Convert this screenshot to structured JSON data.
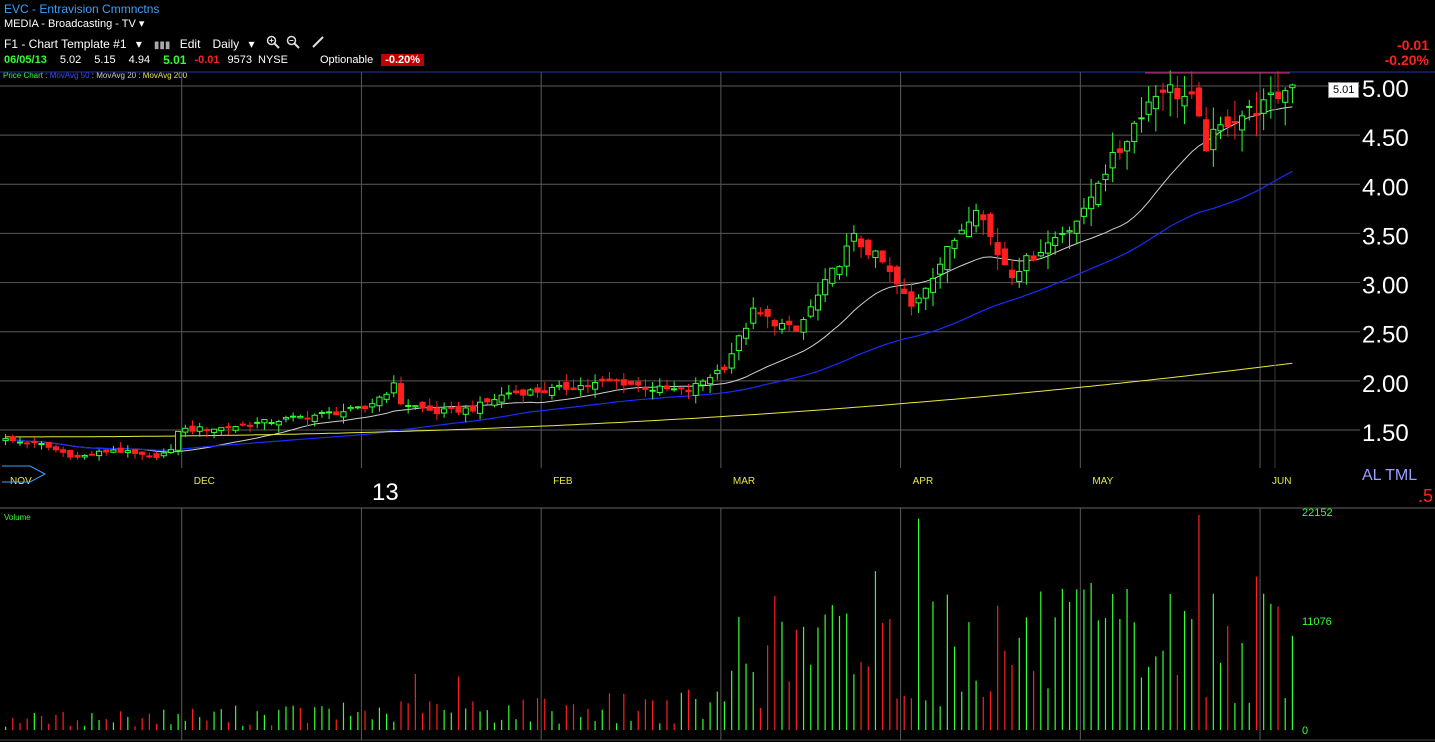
{
  "header": {
    "title": "EVC - Entravision Cmmnctns",
    "sector": "MEDIA - Broadcasting - TV",
    "template": "F1 - Chart Template #1",
    "edit_label": "Edit",
    "period": "Daily",
    "quote": {
      "date": "06/05/13",
      "open": "5.02",
      "high": "5.15",
      "low": "4.94",
      "close": "5.01",
      "change": "-0.01",
      "volume": "9573",
      "exchange": "NYSE",
      "optionable": "Optionable",
      "change_pct": "-0.20%"
    },
    "right_change": "-0.01",
    "right_change_pct": "-0.20%"
  },
  "legend": {
    "price": "Price Chart",
    "ma50": "MovAvg 50",
    "ma20": "MovAvg 20",
    "ma200": "MovAvg 200"
  },
  "colors": {
    "up": "#33ff33",
    "down": "#ff1f1f",
    "ma20": "#cfcfcf",
    "ma50": "#1a2bff",
    "ma200": "#e8e840",
    "grid": "#5a5a5a",
    "title": "#3aa0ff"
  },
  "price_tag": "5.01",
  "overlay": {
    "big_label": "13",
    "al_tml": "AL TML",
    "corner": ".5"
  },
  "volume_label": "Volume",
  "chart_data": [
    {
      "type": "candlestick",
      "title": "EVC - Entravision Cmmnctns",
      "x_tick_labels": [
        "NOV",
        "DEC",
        "FEB",
        "MAR",
        "APR",
        "MAY",
        "JUN"
      ],
      "x_tick_index": [
        0,
        25,
        75,
        100,
        125,
        150,
        175
      ],
      "y_ticks": [
        1.5,
        2.0,
        2.5,
        3.0,
        3.5,
        4.0,
        4.5,
        5.0
      ],
      "y_tick_labels": [
        "1.50",
        "2.00",
        "2.50",
        "3.00",
        "3.50",
        "4.00",
        "4.50",
        "5.00"
      ],
      "ylim": [
        1.05,
        5.15
      ],
      "x_count": 180,
      "anchors": [
        {
          "i": 0,
          "c": 1.4
        },
        {
          "i": 5,
          "c": 1.35
        },
        {
          "i": 10,
          "c": 1.22
        },
        {
          "i": 15,
          "c": 1.3
        },
        {
          "i": 20,
          "c": 1.22
        },
        {
          "i": 23,
          "c": 1.28
        },
        {
          "i": 24,
          "c": 1.5
        },
        {
          "i": 30,
          "c": 1.52
        },
        {
          "i": 40,
          "c": 1.62
        },
        {
          "i": 50,
          "c": 1.72
        },
        {
          "i": 54,
          "c": 1.95
        },
        {
          "i": 55,
          "c": 1.78
        },
        {
          "i": 60,
          "c": 1.68
        },
        {
          "i": 65,
          "c": 1.72
        },
        {
          "i": 70,
          "c": 1.88
        },
        {
          "i": 75,
          "c": 1.9
        },
        {
          "i": 85,
          "c": 2.0
        },
        {
          "i": 90,
          "c": 1.92
        },
        {
          "i": 95,
          "c": 1.9
        },
        {
          "i": 100,
          "c": 2.15
        },
        {
          "i": 104,
          "c": 2.7
        },
        {
          "i": 110,
          "c": 2.5
        },
        {
          "i": 115,
          "c": 3.1
        },
        {
          "i": 118,
          "c": 3.45
        },
        {
          "i": 122,
          "c": 3.2
        },
        {
          "i": 126,
          "c": 2.75
        },
        {
          "i": 130,
          "c": 3.2
        },
        {
          "i": 135,
          "c": 3.8
        },
        {
          "i": 138,
          "c": 3.3
        },
        {
          "i": 140,
          "c": 3.1
        },
        {
          "i": 145,
          "c": 3.4
        },
        {
          "i": 150,
          "c": 3.7
        },
        {
          "i": 152,
          "c": 4.05
        },
        {
          "i": 155,
          "c": 4.35
        },
        {
          "i": 158,
          "c": 4.75
        },
        {
          "i": 161,
          "c": 5.0
        },
        {
          "i": 165,
          "c": 4.85
        },
        {
          "i": 167,
          "c": 4.4
        },
        {
          "i": 170,
          "c": 4.65
        },
        {
          "i": 175,
          "c": 4.8
        },
        {
          "i": 179,
          "c": 5.01
        }
      ],
      "moving_averages": [
        {
          "name": "MovAvg 20",
          "period": 20
        },
        {
          "name": "MovAvg 50",
          "period": 50
        },
        {
          "name": "MovAvg 200",
          "start": 1.43,
          "end": 2.18
        }
      ]
    },
    {
      "type": "bar",
      "title": "Volume",
      "y_ticks": [
        0,
        11076,
        22152
      ],
      "y_tick_labels": [
        "0",
        "11076",
        "22152"
      ],
      "ylim": [
        0,
        22152
      ]
    }
  ]
}
